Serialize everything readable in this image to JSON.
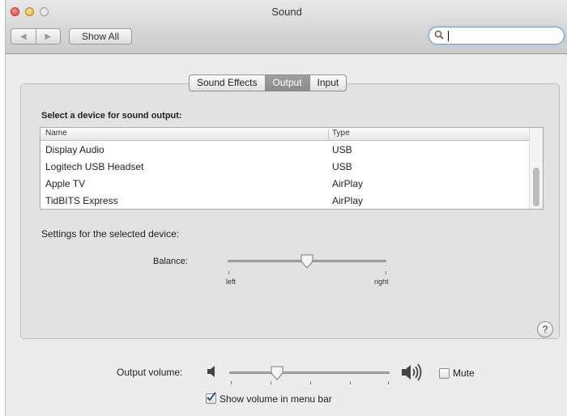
{
  "window": {
    "title": "Sound",
    "nav_back": "◀",
    "nav_forward": "▶",
    "show_all_label": "Show All",
    "search_value": "",
    "accent_color": "#7a9ec4"
  },
  "tabs": [
    {
      "label": "Sound Effects",
      "selected": false
    },
    {
      "label": "Output",
      "selected": true
    },
    {
      "label": "Input",
      "selected": false
    }
  ],
  "output": {
    "section_title": "Select a device for sound output:",
    "columns": {
      "name": "Name",
      "type": "Type"
    },
    "devices": [
      {
        "name": "Display Audio",
        "type": "USB"
      },
      {
        "name": "Logitech USB Headset",
        "type": "USB"
      },
      {
        "name": "Apple TV",
        "type": "AirPlay"
      },
      {
        "name": "TidBITS Express",
        "type": "AirPlay"
      }
    ],
    "settings_label": "Settings for the selected device:",
    "balance_label": "Balance:",
    "balance_left": "left",
    "balance_right": "right",
    "balance_value": 0.5
  },
  "help_label": "?",
  "volume": {
    "label": "Output volume:",
    "value": 0.3,
    "mute_label": "Mute",
    "mute_checked": false,
    "show_in_menu_label": "Show volume in menu bar",
    "show_in_menu_checked": true
  }
}
